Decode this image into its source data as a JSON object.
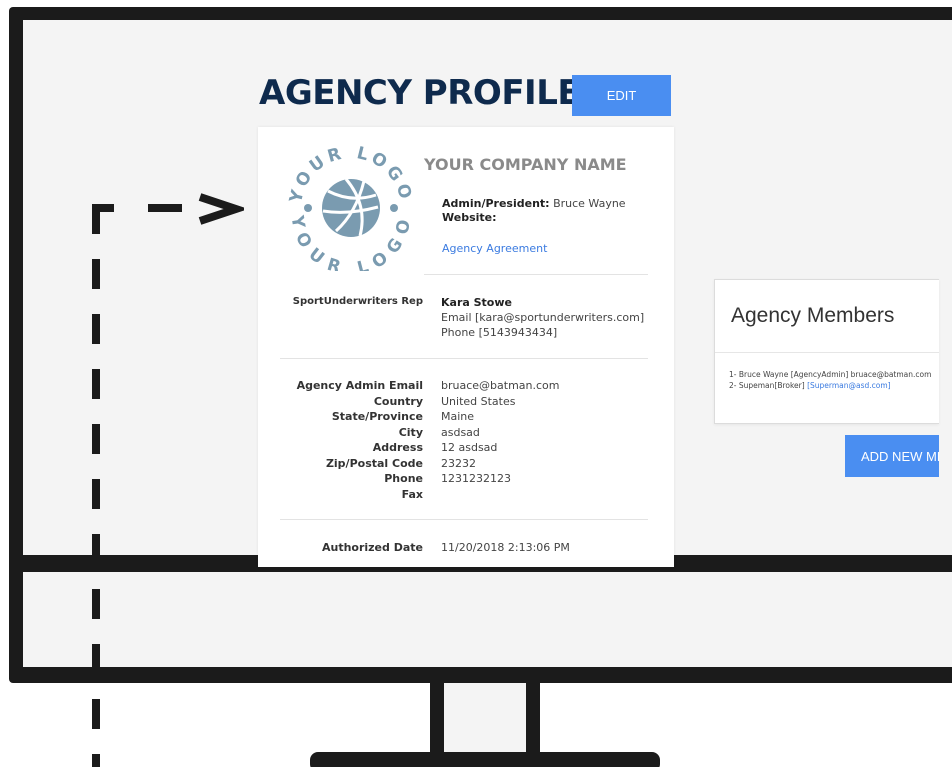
{
  "page": {
    "title": "AGENCY PROFILE",
    "edit_label": "EDIT"
  },
  "profile": {
    "logo_text_top": "YOUR LOGO",
    "logo_text_bottom": "YOUR LOGO",
    "company_name": "YOUR COMPANY NAME",
    "admin_label": "Admin/President:",
    "admin_value": "Bruce Wayne",
    "website_label": "Website:",
    "agreement_link": "Agency Agreement",
    "rep_label": "SportUnderwriters  Rep",
    "rep_name": "Kara Stowe",
    "rep_email": "Email [kara@sportunderwriters.com]",
    "rep_phone": "Phone [5143943434]",
    "fields": [
      {
        "label": "Agency Admin Email",
        "value": "bruace@batman.com"
      },
      {
        "label": "Country",
        "value": "United States"
      },
      {
        "label": "State/Province",
        "value": "Maine"
      },
      {
        "label": "City",
        "value": "asdsad"
      },
      {
        "label": "Address",
        "value": "12 asdsad"
      },
      {
        "label": "Zip/Postal Code",
        "value": "23232"
      },
      {
        "label": "Phone",
        "value": "1231232123"
      },
      {
        "label": "Fax",
        "value": ""
      }
    ],
    "authorized_label": "Authorized Date",
    "authorized_value": "11/20/2018 2:13:06 PM"
  },
  "members": {
    "title": "Agency Members",
    "items": [
      {
        "text": "1- Bruce Wayne [AgencyAdmin] bruace@batman.com",
        "link": ""
      },
      {
        "text": "2- Supeman[Broker] ",
        "link": "[Superman@asd.com]"
      }
    ],
    "add_label": "ADD NEW MEMBER"
  },
  "colors": {
    "accent": "#4a8ef1",
    "title": "#0e2a4d",
    "link": "#3b7be0",
    "logo": "#7a9bb0",
    "frame": "#1b1b1b"
  }
}
